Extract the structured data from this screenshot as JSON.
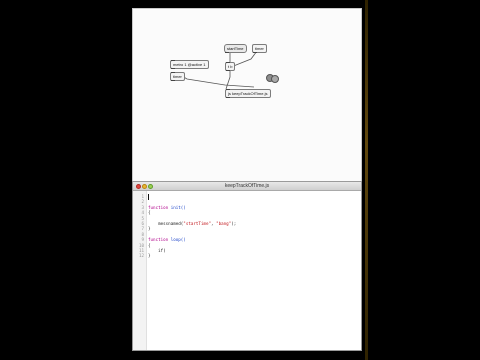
{
  "patcher": {
    "objects": {
      "startTime": "startTime",
      "timer": "timer",
      "prepend": "metro 1 @active 1",
      "timer2": "timer",
      "delay": "t b",
      "js": "js keepTrackOfTime.js"
    }
  },
  "editor": {
    "title": "keepTrackOfTime.js",
    "lines": [
      {
        "n": "1",
        "text": ""
      },
      {
        "n": "2",
        "text": ""
      },
      {
        "n": "3",
        "text": "function init()",
        "kw": "function",
        "fn": "init()"
      },
      {
        "n": "4",
        "text": "{"
      },
      {
        "n": "5",
        "text": ""
      },
      {
        "n": "6",
        "text": "    messnamed(\"startTime\", \"bang\");"
      },
      {
        "n": "7",
        "text": "}"
      },
      {
        "n": "8",
        "text": ""
      },
      {
        "n": "9",
        "text": "function loop()",
        "kw": "function",
        "fn": "loop()"
      },
      {
        "n": "10",
        "text": "{"
      },
      {
        "n": "11",
        "text": "    if("
      },
      {
        "n": "12",
        "text": "}"
      }
    ]
  },
  "colors": {
    "keyword": "#b0008a",
    "function_name": "#1c44c9",
    "string": "#c1141a",
    "background_outer": "#000000"
  }
}
